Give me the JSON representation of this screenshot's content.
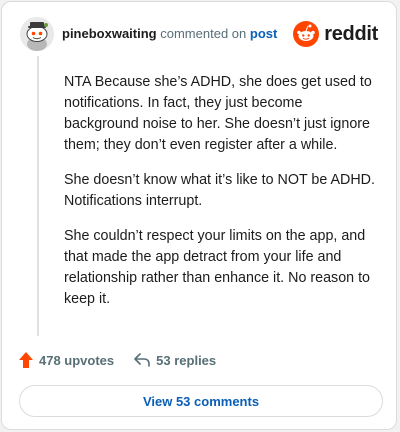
{
  "header": {
    "username": "pineboxwaiting",
    "action_text": "commented on",
    "post_link": "post",
    "brand": "reddit",
    "avatar_icon": "snoo-avatar-icon",
    "brand_icon": "reddit-logo-icon",
    "brand_color": "#ff4500"
  },
  "comment": {
    "paragraphs": [
      "NTA Because she’s ADHD, she does get used to notifications. In fact, they just become background noise to her. She doesn’t just ignore them; they don’t even register after a while.",
      "She doesn’t know what it’s like to NOT be ADHD. Notifications interrupt.",
      "She couldn’t respect your limits on the app, and that made the app detract from your life and relationship rather than enhance it. No reason to keep it."
    ]
  },
  "actions": {
    "upvotes": "478 upvotes",
    "replies": "53 replies",
    "upvote_icon": "upvote-arrow-icon",
    "reply_icon": "reply-arrow-icon",
    "upvote_color": "#ff4500"
  },
  "footer": {
    "view_comments": "View 53 comments"
  }
}
